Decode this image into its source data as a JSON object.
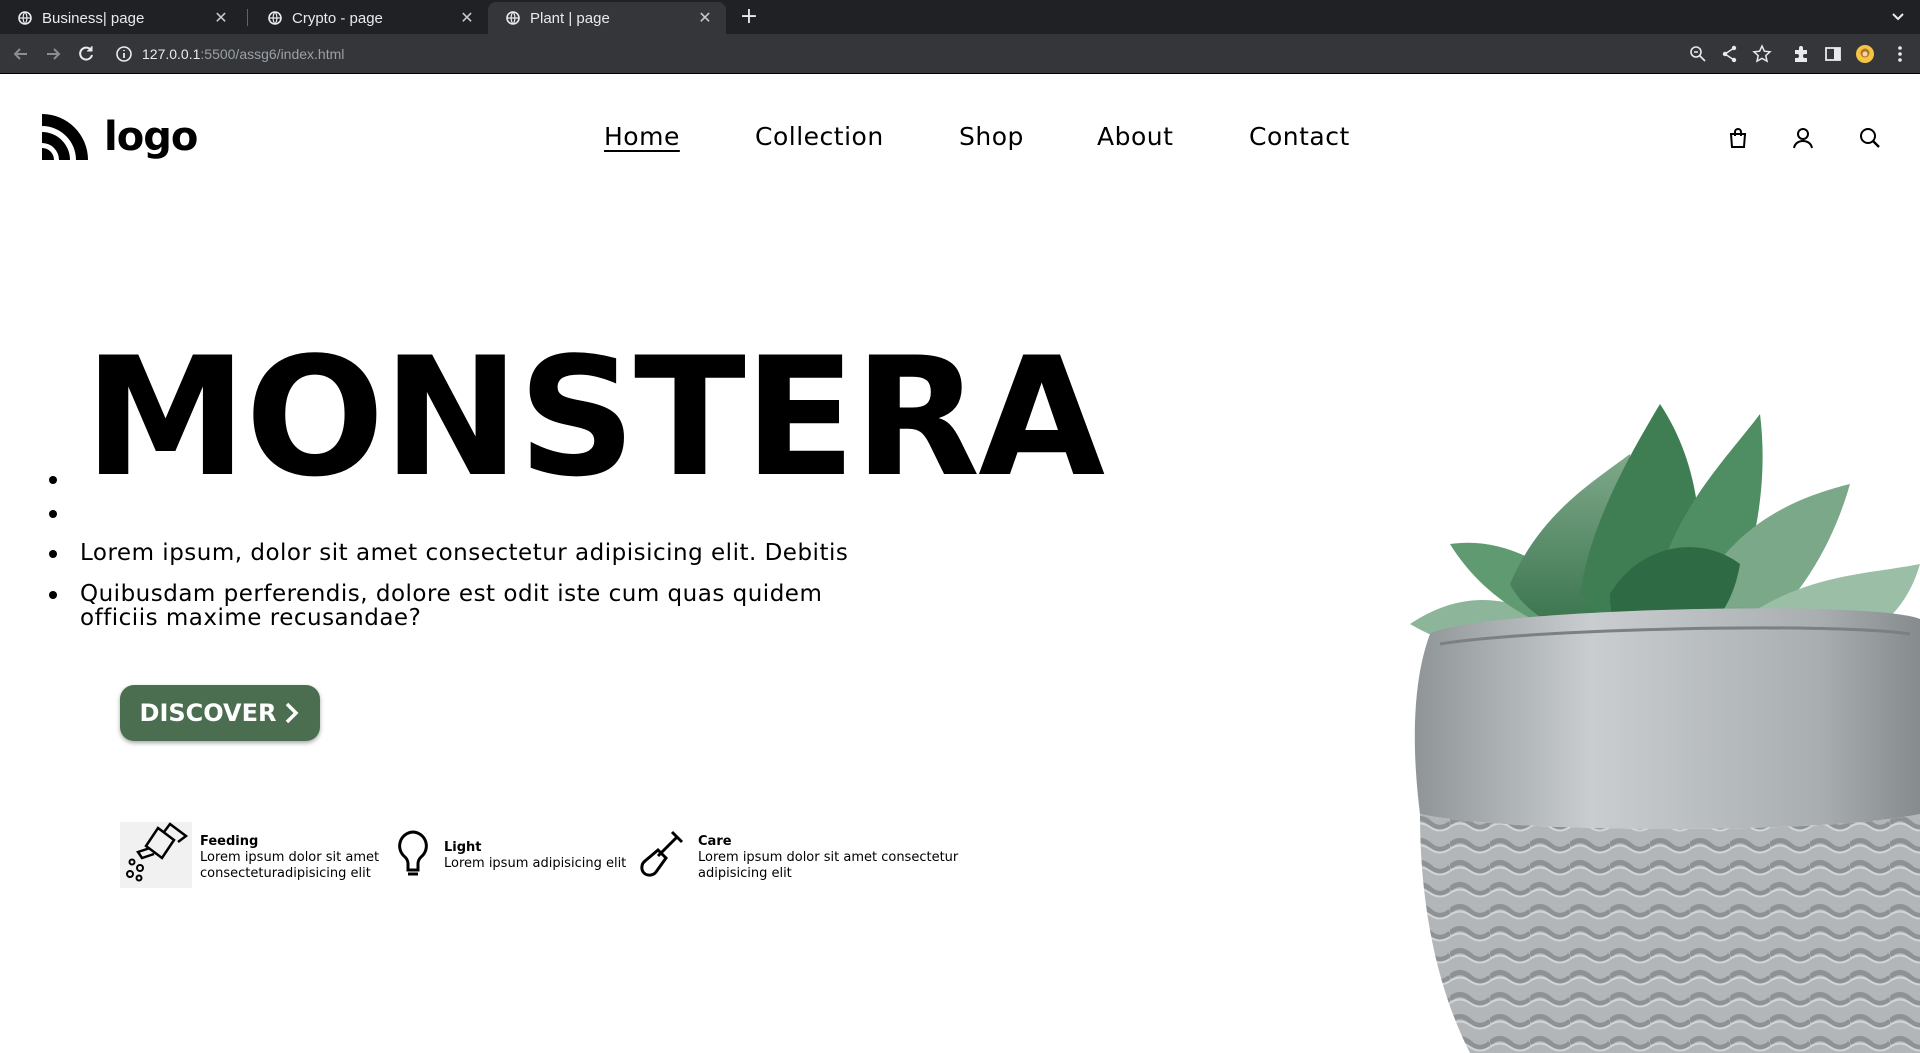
{
  "browser": {
    "tabs": [
      {
        "title": "Business| page",
        "active": false
      },
      {
        "title": "Crypto - page",
        "active": false
      },
      {
        "title": "Plant | page",
        "active": true
      }
    ],
    "new_tab_symbol": "+",
    "tab_close_symbol": "✕",
    "url": {
      "host": "127.0.0.1",
      "path": ":5500/assg6/index.html"
    },
    "icons": [
      "back-icon",
      "forward-icon",
      "reload-icon",
      "site-info-icon",
      "zoom-icon",
      "share-icon",
      "bookmark-star-icon",
      "extensions-icon",
      "side-panel-icon",
      "profile-avatar",
      "more-menu-icon"
    ]
  },
  "site": {
    "logo_text": "logo",
    "nav": [
      "Home",
      "Collection",
      "Shop",
      "About",
      "Contact"
    ],
    "active_nav": "Home",
    "header_icons": [
      "shopping-bag-icon",
      "user-icon",
      "search-icon"
    ]
  },
  "hero": {
    "title": "MONSTERA",
    "lines": [
      "Lorem ipsum, dolor sit amet consectetur adipisicing elit. Debitis",
      "Quibusdam perferendis, dolore est odit iste cum quas quidem",
      "officiis maxime recusandae?"
    ],
    "button_label": "DISCOVER",
    "button_color": "#4a6e4f"
  },
  "features": [
    {
      "title": "Feeding",
      "line1": "Lorem ipsum dolor sit amet",
      "line2": "consecteturadipisicing elit",
      "icon": "watering-can-icon"
    },
    {
      "title": "Light",
      "line1": "Lorem ipsum adipisicing elit",
      "line2": "",
      "icon": "light-bulb-icon"
    },
    {
      "title": "Care",
      "line1": "Lorem ipsum dolor sit amet consectetur",
      "line2": "adipisicing elit",
      "icon": "shovel-icon"
    }
  ]
}
